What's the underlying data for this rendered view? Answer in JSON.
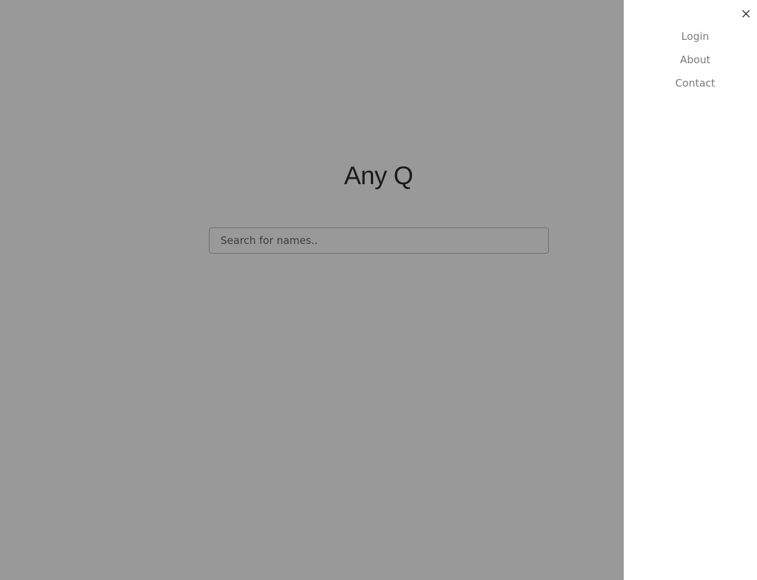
{
  "header": {
    "title": "Any Q"
  },
  "search": {
    "placeholder": "Search for names..",
    "value": ""
  },
  "drawer": {
    "close_icon": "close-icon",
    "items": [
      {
        "label": "Login"
      },
      {
        "label": "About"
      },
      {
        "label": "Contact"
      }
    ]
  },
  "colors": {
    "overlay": "#999999",
    "drawer_background": "#ffffff",
    "link": "#7a7a7a",
    "title": "#1a1a1a"
  }
}
